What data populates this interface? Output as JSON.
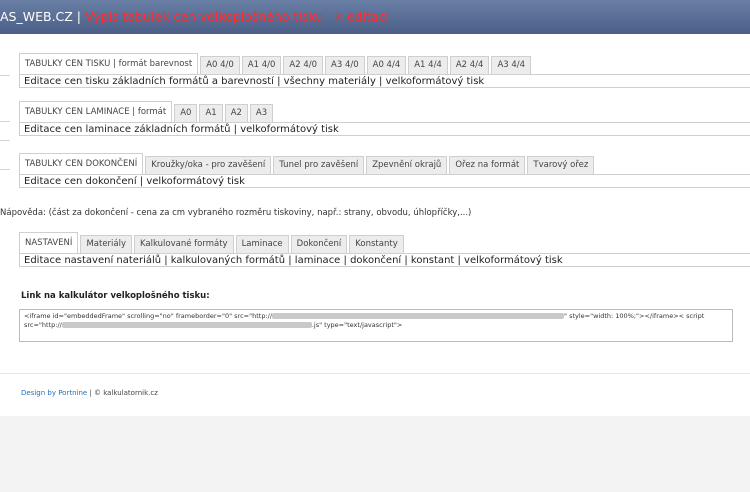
{
  "header": {
    "site": "AS_WEB.CZ |",
    "page_title": "Výpis tabulek cen velkoplošného tisku - k editaci"
  },
  "print_section": {
    "tabs": [
      "TABULKY CEN TISKU | formát barevnost",
      "A0 4/0",
      "A1 4/0",
      "A2 4/0",
      "A3 4/0",
      "A0 4/4",
      "A1 4/4",
      "A2 4/4",
      "A3 4/4"
    ],
    "description": "Editace cen tisku základních formátů a barevností | všechny materiály | velkoformátový tisk"
  },
  "lamination_section": {
    "tabs": [
      "TABULKY CEN LAMINACE | formát",
      "A0",
      "A1",
      "A2",
      "A3"
    ],
    "description": "Editace cen laminace základních formátů | velkoformátový tisk"
  },
  "finishing_section": {
    "tabs": [
      "TABULKY CEN DOKONČENÍ",
      "Kroužky/oka - pro zavěšení",
      "Tunel pro zavěšení",
      "Zpevnění okrajů",
      "Ořez na formát",
      "Tvarový ořez"
    ],
    "description": "Editace cen dokončení | velkoformátový tisk"
  },
  "help_text": "Nápověda: (část za dokončení - cena za cm vybraného rozměru tiskoviny, např.: strany, obvodu, úhlopříčky,...)",
  "settings_section": {
    "tabs": [
      "NASTAVENÍ",
      "Materiály",
      "Kalkulované formáty",
      "Laminace",
      "Dokončení",
      "Konstanty"
    ],
    "description": "Editace nastavení nateriálů | kalkulovaných formátů | laminace | dokončení | konstant | velkoformátový tisk"
  },
  "link_section": {
    "label": "Link na kalkulátor velkoplošného tisku:",
    "code_line1_start": "<iframe id=\"embeddedFrame\" scrolling=\"no\" frameborder=\"0\" src=\"http://",
    "code_line1_end": "\" style=\"width: 100%;\"></iframe>< script",
    "code_line2_start": "src=\"http://",
    "code_line2_end": ".js\" type=\"text/javascript\">"
  },
  "footer": {
    "link": "Design by Portnine",
    "text": " | © kalkulatornik.cz"
  }
}
